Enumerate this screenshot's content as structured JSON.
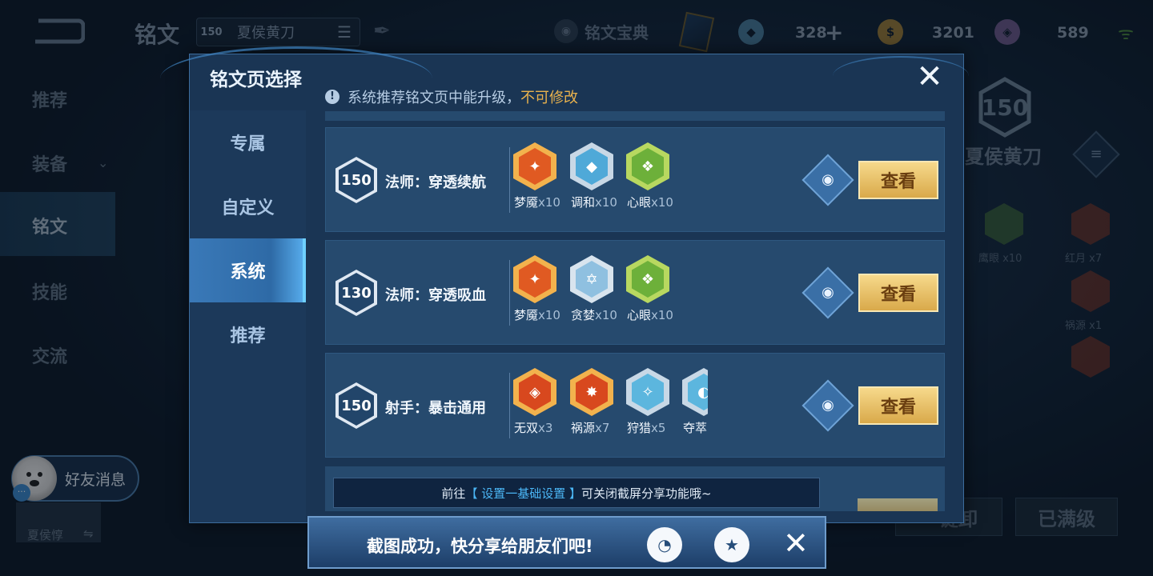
{
  "topbar": {
    "title": "铭文",
    "hero_level": "150",
    "hero_name": "夏侯黄刀",
    "codex_label": "铭文宝典",
    "currency_1": "328",
    "currency_2": "3201",
    "currency_3": "589"
  },
  "left_nav": {
    "items": [
      "推荐",
      "装备",
      "铭文",
      "技能",
      "交流"
    ]
  },
  "right_panel": {
    "level": "150",
    "hero_name": "夏侯黄刀",
    "rune_labels": [
      "鹰眼 x10",
      "红月 x7",
      "祸源 x1"
    ],
    "btn_unload": "一键卸",
    "btn_maxed": "已满级"
  },
  "friend": {
    "label": "好友消息",
    "player_name": "夏侯惇",
    "swap_icon": "⇋"
  },
  "modal": {
    "title": "铭文页选择",
    "notice": "系统推荐铭文页中能升级，",
    "notice_warn": "不可修改",
    "tabs": [
      "专属",
      "自定义",
      "系统",
      "推荐"
    ],
    "active_tab": 2,
    "rows": [
      {
        "level": "150",
        "name": "法师：穿透续航",
        "runes": [
          {
            "name": "梦魇",
            "count": "x10",
            "icon": "nightmare-rune-icon",
            "color": "#e05a22"
          },
          {
            "name": "调和",
            "count": "x10",
            "icon": "harmony-rune-icon",
            "color": "#4fa9d8"
          },
          {
            "name": "心眼",
            "count": "x10",
            "icon": "mind-eye-rune-icon",
            "color": "#6db03a"
          }
        ],
        "view_label": "查看"
      },
      {
        "level": "130",
        "name": "法师：穿透吸血",
        "runes": [
          {
            "name": "梦魇",
            "count": "x10",
            "icon": "nightmare-rune-icon",
            "color": "#e05a22"
          },
          {
            "name": "贪婪",
            "count": "x10",
            "icon": "greed-rune-icon",
            "color": "#8fc0e0"
          },
          {
            "name": "心眼",
            "count": "x10",
            "icon": "mind-eye-rune-icon",
            "color": "#6db03a"
          }
        ],
        "view_label": "查看"
      },
      {
        "level": "150",
        "name": "射手：暴击通用",
        "runes": [
          {
            "name": "无双",
            "count": "x3",
            "icon": "peerless-rune-icon",
            "color": "#d8481e"
          },
          {
            "name": "祸源",
            "count": "x7",
            "icon": "calamity-rune-icon",
            "color": "#d8481e"
          },
          {
            "name": "狩猎",
            "count": "x5",
            "icon": "hunt-rune-icon",
            "color": "#5cb6de"
          },
          {
            "name": "夺萃",
            "count": "",
            "icon": "plunder-rune-icon",
            "color": "#5cb6de"
          }
        ],
        "view_label": "查看"
      }
    ],
    "tip_prefix": "前往",
    "tip_highlight": "【 设置一基础设置 】",
    "tip_suffix": "可关闭截屏分享功能哦~"
  },
  "share_bar": {
    "text": "截图成功，快分享给朋友们吧!"
  },
  "colors": {
    "accent": "#3a79b8",
    "gold_button": "#e6bd62",
    "warn": "#e9b24d",
    "highlight": "#4bb6f5"
  }
}
